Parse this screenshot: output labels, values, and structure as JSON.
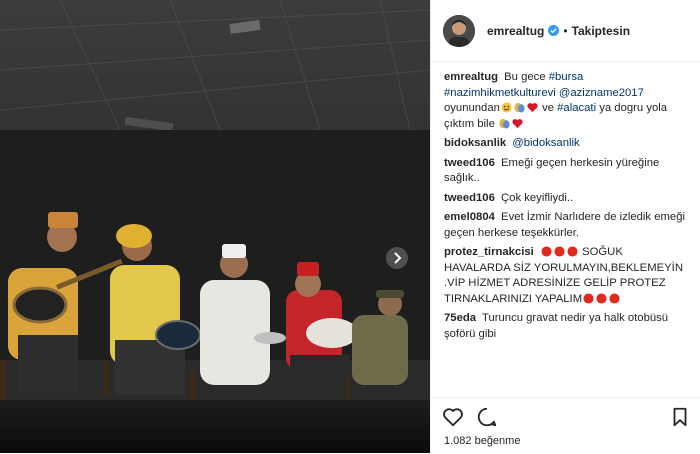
{
  "post": {
    "username": "emrealtug",
    "follow_status": "Takiptesin",
    "dot": "•",
    "caption": {
      "username": "emrealtug",
      "text_1": "Bu gece",
      "tag_bursa": "#bursa",
      "tag_nhk": "#nazimhikmetkulturevi",
      "tag_aziz": "@aziznamе2017",
      "text_2": "oyunundan",
      "text_3": "ve",
      "tag_alacati": "#alacati",
      "text_4": "ya dogru yola çıktım bile"
    },
    "likes": "1.082 beğenme"
  },
  "comments": [
    {
      "user": "bidoksanlik",
      "mention": "@bidoksanlik",
      "text": ""
    },
    {
      "user": "tweed106",
      "text": "Emeği geçen herkesin yüreğine sağlık.."
    },
    {
      "user": "tweed106",
      "text": "Çok keyifliydi.."
    },
    {
      "user": "emel0804",
      "text": "Evet İzmir Narlıdere de izledik emeği geçen herkese teşekkürler."
    },
    {
      "user": "protez_tirnakcisi",
      "text": "SOĞUK HAVALARDA SİZ YORULMAYIN,BEKLEMEYİN .VİP HİZMET ADRESİNİZE GELİP PROTEZ TIRNAKLARINIZI YAPALIM"
    },
    {
      "user": "75eda",
      "text": "Turuncu gravat nedir ya halk otobüsü şoförü gibi"
    }
  ],
  "icons": {
    "heart": "heart-icon",
    "comment": "comment-icon",
    "bookmark": "bookmark-icon"
  },
  "colors": {
    "link": "#003569",
    "verified": "#3897f0",
    "red_circle": "#e0291f",
    "stage_floor": "#101010"
  }
}
